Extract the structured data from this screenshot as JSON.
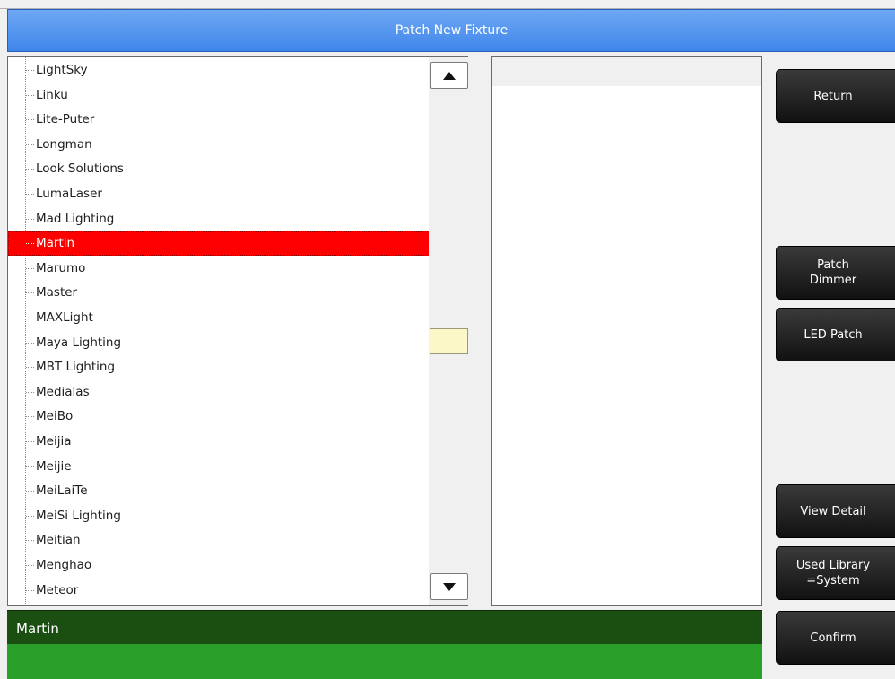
{
  "window": {
    "title": "Patch New Fixture"
  },
  "manufacturers": [
    "LightSky",
    "Linku",
    "Lite-Puter",
    "Longman",
    "Look Solutions",
    "LumaLaser",
    "Mad Lighting",
    "Martin",
    "Marumo",
    "Master",
    "MAXLight",
    "Maya Lighting",
    "MBT Lighting",
    "Medialas",
    "MeiBo",
    "Meijia",
    "Meijie",
    "MeiLaiTe",
    "MeiSi Lighting",
    "Meitian",
    "Menghao",
    "Meteor"
  ],
  "selected_manufacturer": "Martin",
  "status": {
    "selected_text": "Martin"
  },
  "buttons": {
    "return": "Return",
    "patch_dimmer": "Patch\nDimmer",
    "led_patch": "LED Patch",
    "view_detail": "View Detail",
    "used_library": "Used Library\n=System",
    "confirm": "Confirm"
  },
  "icons": {
    "scroll_up": "triangle-up-icon",
    "scroll_down": "triangle-down-icon"
  },
  "colors": {
    "title_bar": "#4a8ff0",
    "selection": "#ff0000",
    "status_dark": "#1b4f12",
    "status_green": "#2aa02a",
    "scroll_thumb": "#fbf7c6",
    "button": "#1a1a1a"
  }
}
